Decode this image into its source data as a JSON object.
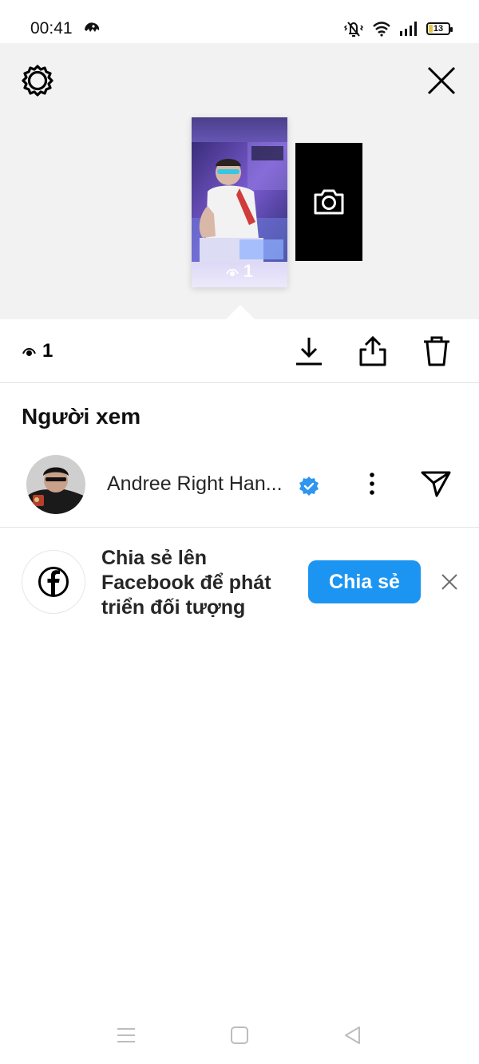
{
  "status_bar": {
    "time": "00:41",
    "battery_level": "13",
    "icons": [
      "app-notification-icon",
      "mute-vibrate-icon",
      "wifi-icon",
      "signal-icon",
      "battery-icon"
    ]
  },
  "preview": {
    "story_view_count": "1",
    "camera_icon": "camera-icon"
  },
  "actions": {
    "view_count": "1",
    "icons": [
      "eye-icon",
      "download-icon",
      "share-icon",
      "trash-icon"
    ]
  },
  "viewers": {
    "title": "Người xem",
    "list": [
      {
        "name": "Andree Right Han...",
        "verified": true
      }
    ]
  },
  "facebook_prompt": {
    "text": "Chia sẻ lên Facebook để phát triển đối tượng",
    "button_label": "Chia sẻ"
  },
  "colors": {
    "accent": "#1b95f1",
    "verified": "#2e95f0",
    "preview_bg": "#f2f2f2"
  }
}
